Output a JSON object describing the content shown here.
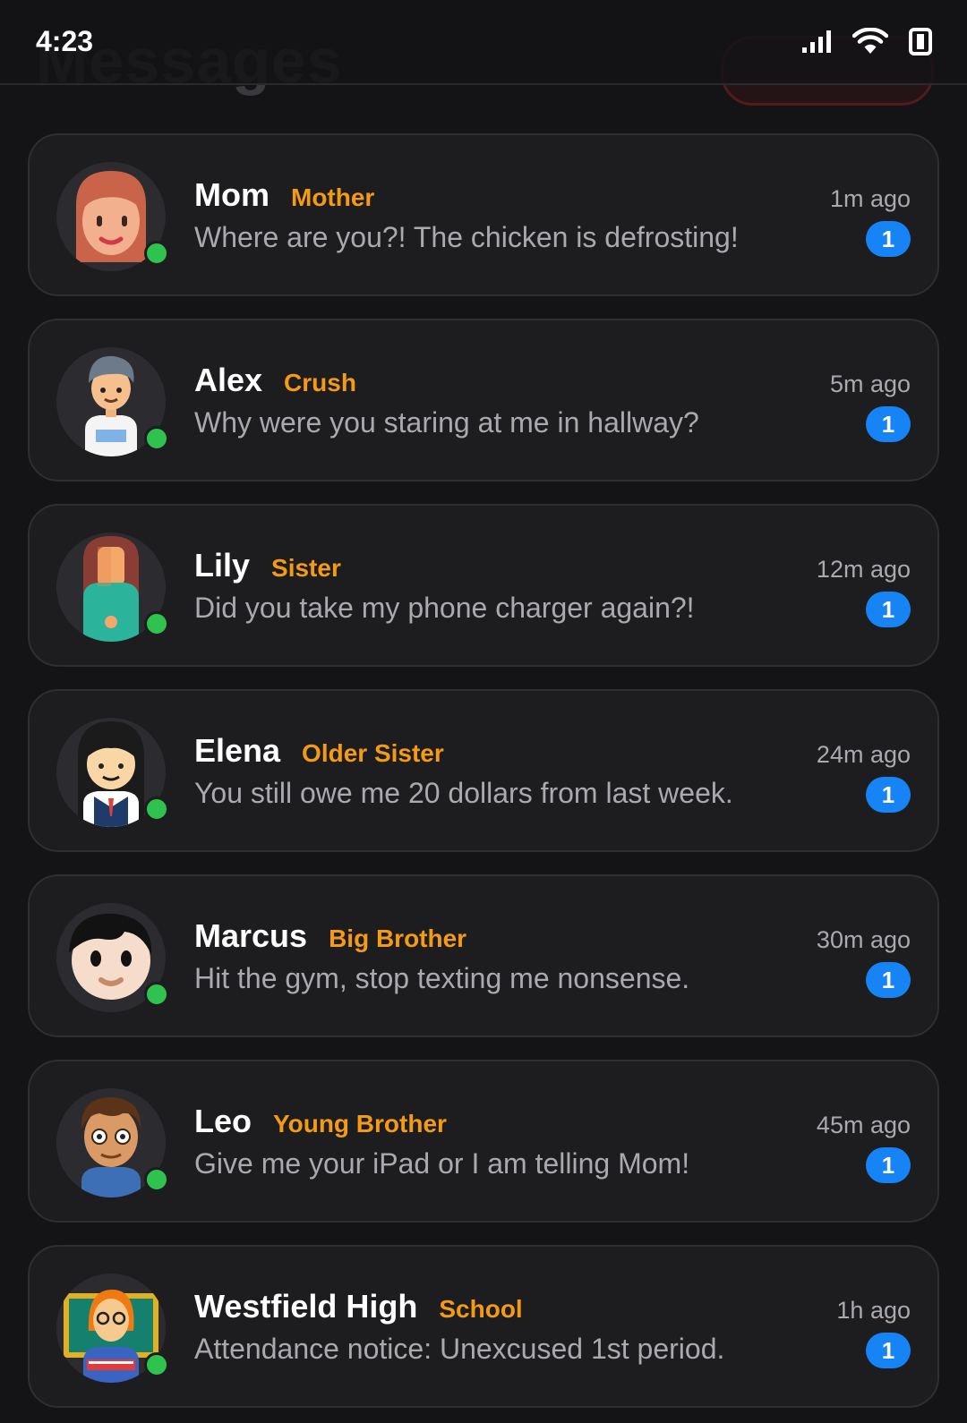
{
  "status_bar": {
    "time": "4:23",
    "icons": [
      "signal-icon",
      "wifi-icon",
      "battery-icon"
    ]
  },
  "header": {
    "title": "Messages"
  },
  "colors": {
    "background": "#141416",
    "card": "#1d1d20",
    "relation": "#f39a16",
    "badge": "#1784f5",
    "online": "#2fc24e"
  },
  "conversations": [
    {
      "name": "Mom",
      "relation": "Mother",
      "preview": "Where are you?! The chicken is defrosting!",
      "time": "1m ago",
      "unread": "1",
      "avatar": "mom-avatar-icon"
    },
    {
      "name": "Alex",
      "relation": "Crush",
      "preview": "Why were you staring at me in hallway?",
      "time": "5m ago",
      "unread": "1",
      "avatar": "alex-avatar-icon"
    },
    {
      "name": "Lily",
      "relation": "Sister",
      "preview": "Did you take my phone charger again?!",
      "time": "12m ago",
      "unread": "1",
      "avatar": "lily-avatar-icon"
    },
    {
      "name": "Elena",
      "relation": "Older Sister",
      "preview": "You still owe me 20 dollars from last week.",
      "time": "24m ago",
      "unread": "1",
      "avatar": "elena-avatar-icon"
    },
    {
      "name": "Marcus",
      "relation": "Big Brother",
      "preview": "Hit the gym, stop texting me nonsense.",
      "time": "30m ago",
      "unread": "1",
      "avatar": "marcus-avatar-icon"
    },
    {
      "name": "Leo",
      "relation": "Young Brother",
      "preview": "Give me your iPad or I am telling Mom!",
      "time": "45m ago",
      "unread": "1",
      "avatar": "leo-avatar-icon"
    },
    {
      "name": "Westfield High",
      "relation": "School",
      "preview": "Attendance notice: Unexcused 1st period.",
      "time": "1h ago",
      "unread": "1",
      "avatar": "school-avatar-icon"
    }
  ]
}
